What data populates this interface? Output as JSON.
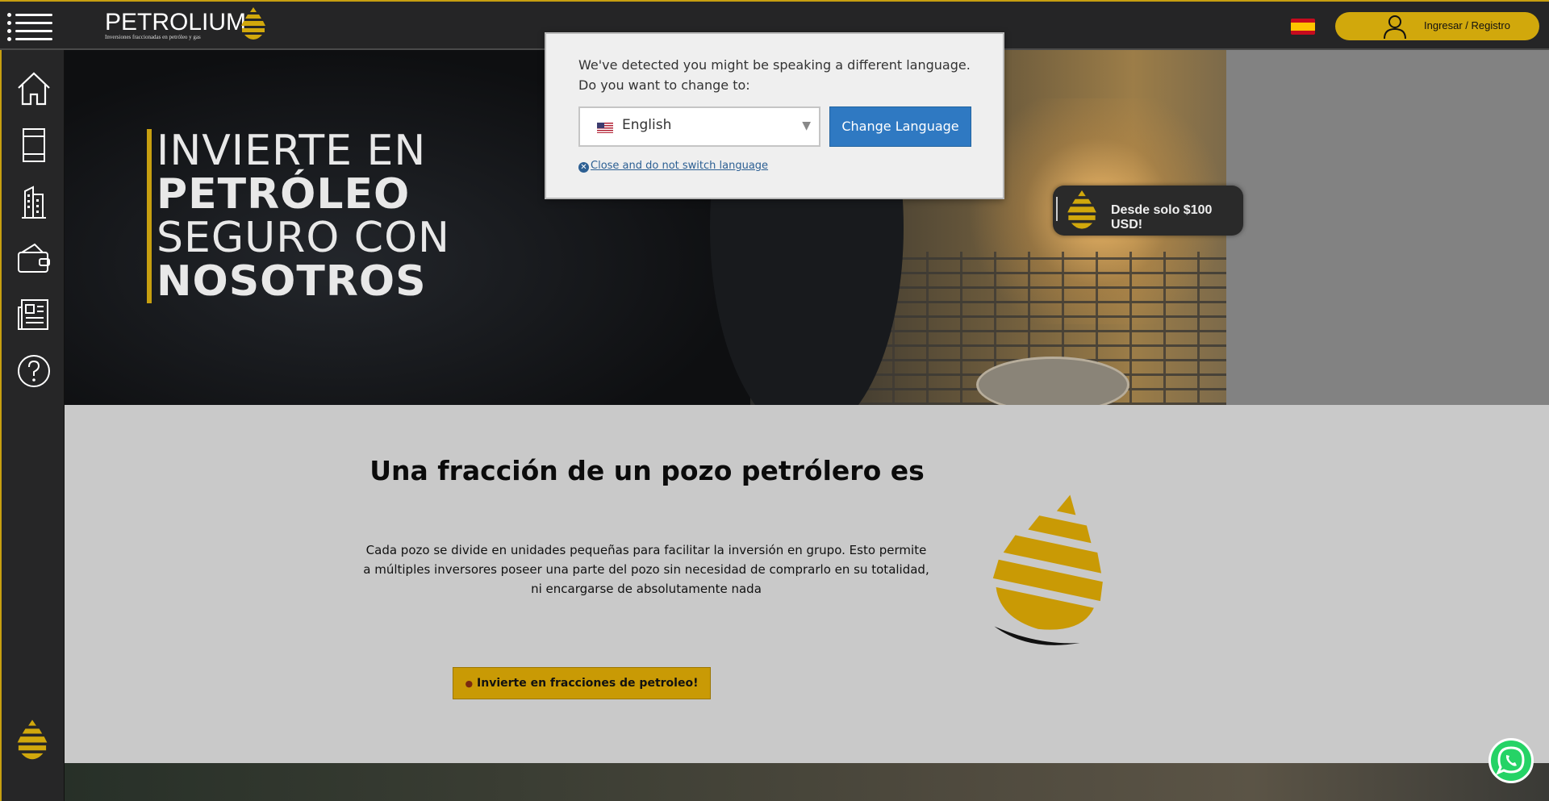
{
  "header": {
    "brand": "PETROLIUM",
    "tagline": "Inversiones fraccionadas en petróleo y gas",
    "language_flag": "es-flag-icon",
    "login_label": "Ingresar / Registro"
  },
  "sidebar": {
    "items": [
      {
        "icon": "home-icon"
      },
      {
        "icon": "oil-barrel-icon"
      },
      {
        "icon": "building-icon"
      },
      {
        "icon": "wallet-icon"
      },
      {
        "icon": "newspaper-icon"
      },
      {
        "icon": "help-icon"
      }
    ]
  },
  "hero": {
    "line1": "INVIERTE EN",
    "line2": "PETRÓLEO",
    "line3": "SEGURO CON",
    "line4": "NOSOTROS"
  },
  "promo": {
    "text": "Desde solo $100 USD!"
  },
  "section2": {
    "title": "Una fracción de un pozo petrólero es",
    "body": "Cada pozo se divide en unidades pequeñas para facilitar la inversión en grupo. Esto permite a múltiples inversores poseer una parte del pozo sin necesidad de comprarlo en su totalidad, ni encargarse de absolutamente nada",
    "button": "Invierte en fracciones de petroleo!"
  },
  "language_modal": {
    "message": "We've detected you might be speaking a different language. Do you want to change to:",
    "selected_language": "English",
    "change_button": "Change Language",
    "close_link": "Close and do not switch language"
  },
  "colors": {
    "accent_gold": "#c99a05",
    "modal_button_blue": "#2f79c2",
    "whatsapp_green": "#25d366"
  }
}
